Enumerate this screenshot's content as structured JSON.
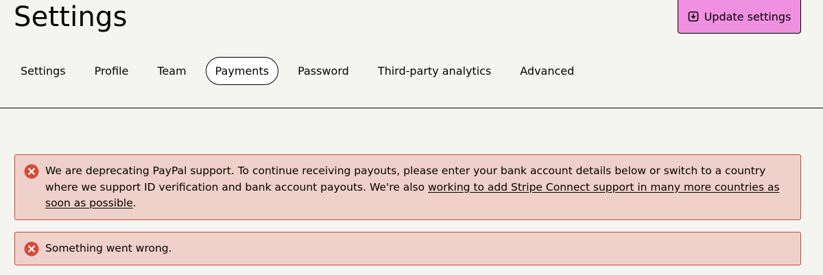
{
  "header": {
    "title": "Settings",
    "update_button_label": "Update settings",
    "update_button_icon": "save-download-icon",
    "accent_color": "#f090e0"
  },
  "tabs": [
    {
      "label": "Settings",
      "active": false
    },
    {
      "label": "Profile",
      "active": false
    },
    {
      "label": "Team",
      "active": false
    },
    {
      "label": "Payments",
      "active": true
    },
    {
      "label": "Password",
      "active": false
    },
    {
      "label": "Third-party analytics",
      "active": false
    },
    {
      "label": "Advanced",
      "active": false
    }
  ],
  "alerts": [
    {
      "icon": "error-x-icon",
      "text_before_link": "We are deprecating PayPal support. To continue receiving payouts, please enter your bank account details below or switch to a country where we support ID verification and bank account payouts. We're also ",
      "link_text": "working to add Stripe Connect support in many more countries as soon as possible",
      "text_after_link": "."
    },
    {
      "icon": "error-x-icon",
      "text": "Something went wrong."
    }
  ],
  "colors": {
    "background": "#f4f4f0",
    "alert_background": "#f0d0ca",
    "alert_border": "#cc4433",
    "error_icon": "#d84a35"
  }
}
